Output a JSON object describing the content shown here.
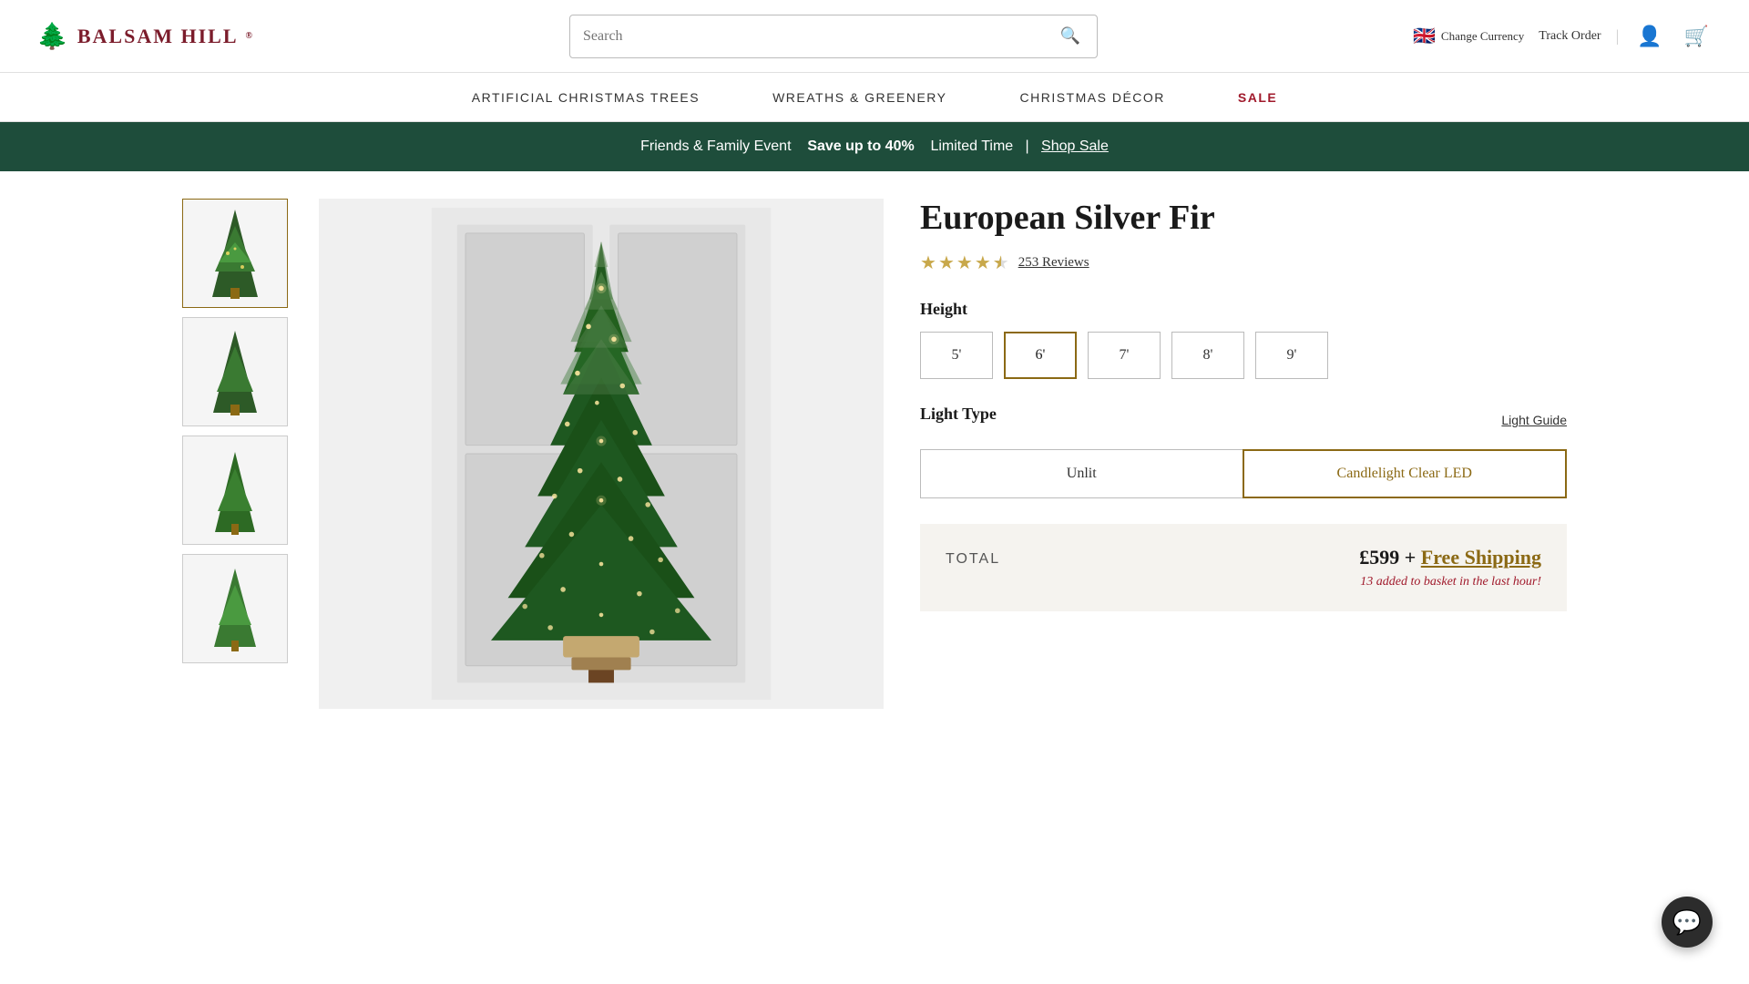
{
  "header": {
    "logo_text": "BALSAM HILL",
    "search_placeholder": "Search",
    "currency_label": "Change Currency",
    "track_order_label": "Track Order",
    "flag_emoji": "🇬🇧"
  },
  "nav": {
    "items": [
      {
        "label": "ARTIFICIAL CHRISTMAS TREES",
        "id": "artificial-trees",
        "is_sale": false
      },
      {
        "label": "WREATHS & GREENERY",
        "id": "wreaths",
        "is_sale": false
      },
      {
        "label": "CHRISTMAS DÉCOR",
        "id": "decor",
        "is_sale": false
      },
      {
        "label": "SALE",
        "id": "sale",
        "is_sale": true
      }
    ]
  },
  "promo_banner": {
    "text_before": "Friends & Family Event",
    "bold_text": "Save up to 40%",
    "text_after": "Limited Time",
    "separator": "|",
    "link_label": "Shop Sale"
  },
  "product": {
    "title": "European Silver Fir",
    "rating": 4.5,
    "review_count": "253 Reviews",
    "height_label": "Height",
    "height_options": [
      "5'",
      "6'",
      "7'",
      "8'",
      "9'"
    ],
    "selected_height": "6'",
    "light_type_label": "Light Type",
    "light_guide_label": "Light Guide",
    "light_options": [
      "Unlit",
      "Candlelight Clear LED"
    ],
    "selected_light": "Candlelight Clear LED",
    "total_label": "TOTAL",
    "total_price": "£599",
    "free_shipping_label": "Free Shipping",
    "basket_urgent_text": "13 added to basket in the last hour!"
  },
  "chat": {
    "icon": "💬"
  }
}
